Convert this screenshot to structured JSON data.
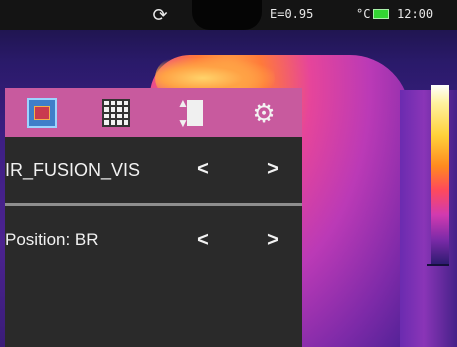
{
  "status": {
    "emissivity": "E=0.95",
    "unit": "°C",
    "time": "12:00"
  },
  "toolbar": {
    "items": [
      {
        "icon": "image-fusion-icon"
      },
      {
        "icon": "grid-icon"
      },
      {
        "icon": "range-scale-icon"
      },
      {
        "icon": "gear-icon"
      }
    ]
  },
  "menu": {
    "rows": [
      {
        "label": "IR_FUSION_VIS",
        "prev": "<",
        "next": ">"
      },
      {
        "label": "Position: BR",
        "prev": "<",
        "next": ">"
      }
    ]
  },
  "colors": {
    "toolbar_bg": "#c85a9e",
    "menu_bg": "#2a2a2a",
    "status_bg": "#141414"
  }
}
